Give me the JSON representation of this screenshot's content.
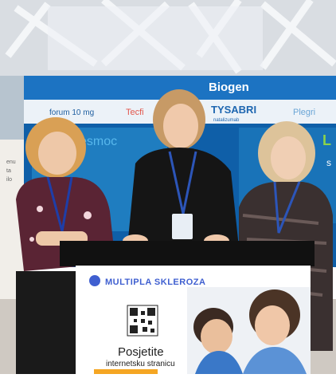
{
  "booth": {
    "brand": "Biogen",
    "banner_items": [
      "forum 10 mg",
      "Tecfi",
      "TYSABRI",
      "Plegri"
    ],
    "tysabri_sub": "natalizumab",
    "side_text": "esmoc",
    "side_letter_right": "L",
    "side_letter_s": "s",
    "left_panel_text": [
      "enu",
      "ta",
      "ilo"
    ]
  },
  "poster": {
    "title": "MULTIPLA SKLEROZA",
    "headline": "Posjetite",
    "subline": "internetsku stranicu"
  },
  "colors": {
    "brand_blue": "#1e66b0",
    "banner_bg": "#0f5fa8",
    "poster_bg": "#ffffff",
    "accent_orange": "#f5a623"
  }
}
